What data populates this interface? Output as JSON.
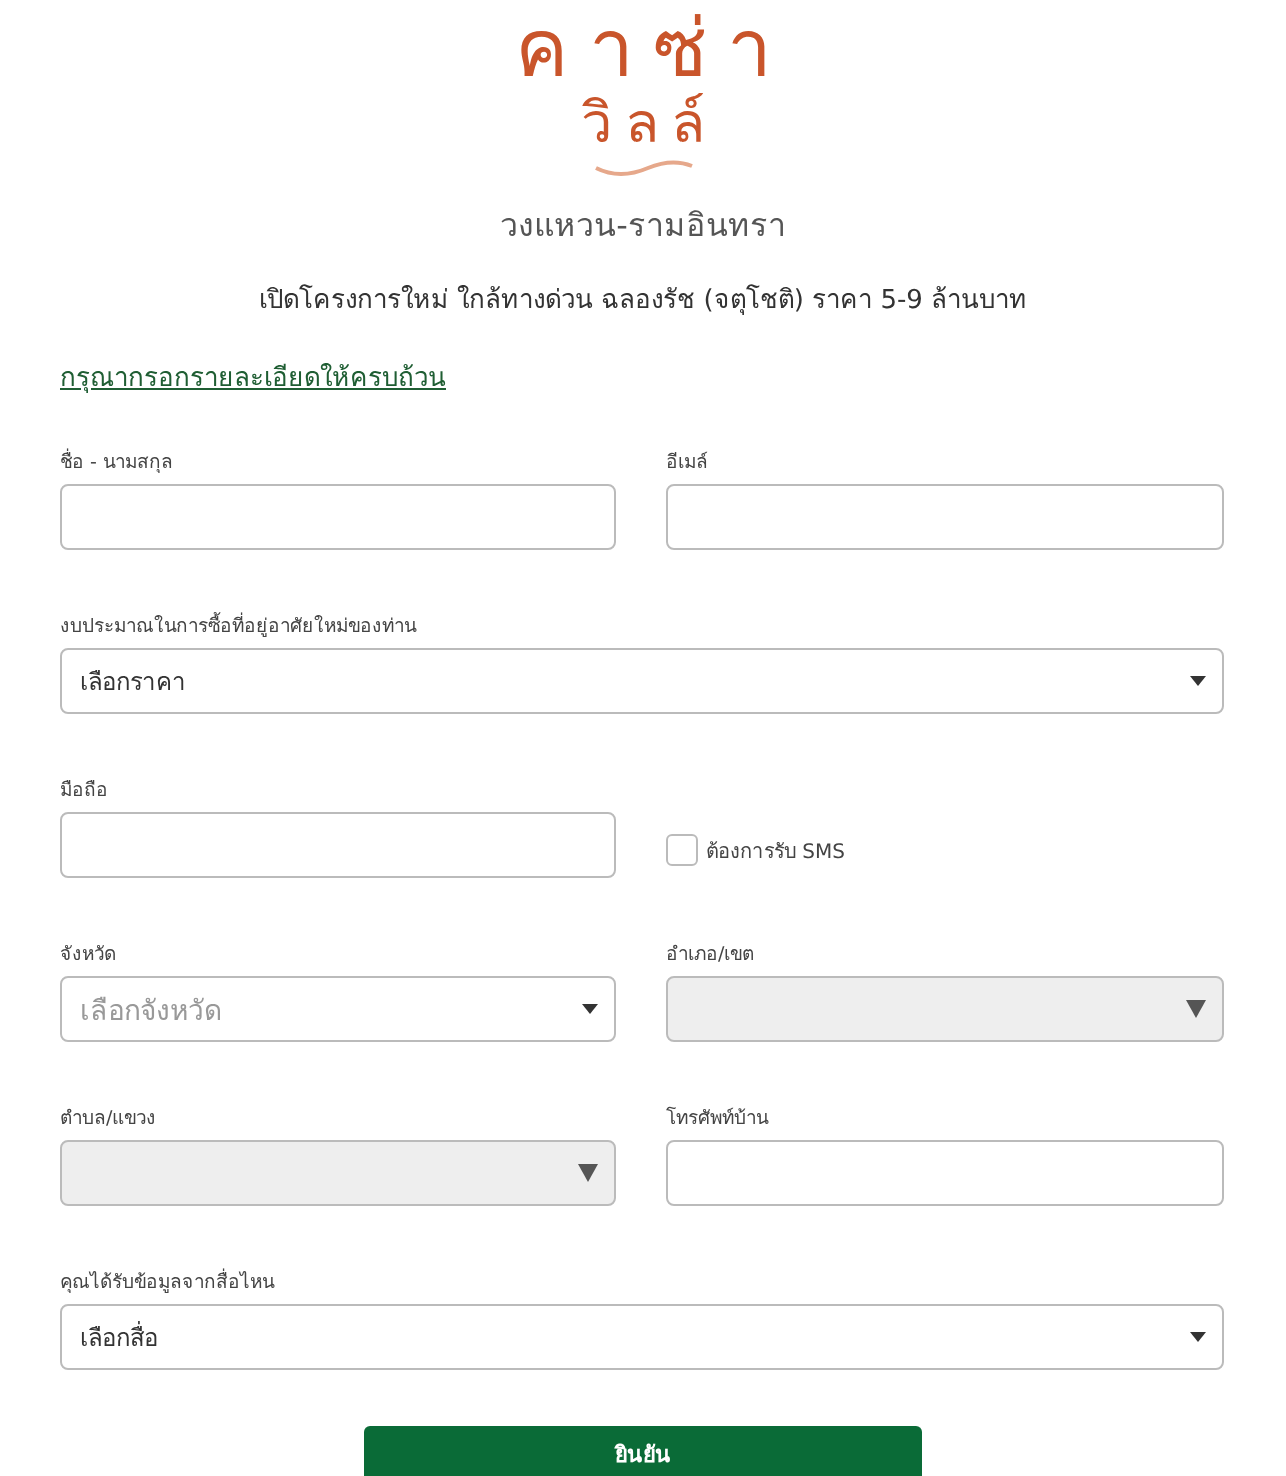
{
  "logo": {
    "line1": "คาซ่า",
    "line2": "วิลล์"
  },
  "project_name": "วงแหวน-รามอินทรา",
  "tagline": "เปิดโครงการใหม่ ใกล้ทางด่วน ฉลองรัช (จตุโชติ) ราคา 5-9 ล้านบาท",
  "instruction_link": "กรุณากรอกรายละเอียดให้ครบถ้วน",
  "fields": [
    {
      "kind": "text",
      "label": "ชื่อ - นามสกุล",
      "wide": false
    },
    {
      "kind": "text",
      "label": "อีเมล์",
      "wide": false
    },
    {
      "kind": "select",
      "label": "งบประมาณในการซื้อที่อยู่อาศัยใหม่ของท่าน",
      "value": "เลือกราคา",
      "wide": true,
      "disabled": false
    },
    {
      "kind": "text",
      "label": "มือถือ",
      "wide": false
    },
    {
      "kind": "checkbox",
      "label": "ต้องการรับ SMS",
      "checked": false
    },
    {
      "kind": "select",
      "label": "จังหวัด",
      "placeholder": "เลือกจังหวัด",
      "wide": false,
      "disabled": false
    },
    {
      "kind": "select",
      "label": "อำเภอ/เขต",
      "wide": false,
      "disabled": true
    },
    {
      "kind": "select",
      "label": "ตำบล/แขวง",
      "wide": false,
      "disabled": true
    },
    {
      "kind": "text",
      "label": "โทรศัพท์บ้าน",
      "wide": false
    },
    {
      "kind": "select",
      "label": "คุณได้รับข้อมูลจากสื่อไหน",
      "value": "เลือกสื่อ",
      "wide": true,
      "disabled": false
    }
  ],
  "submit_button": "ยินยัน"
}
